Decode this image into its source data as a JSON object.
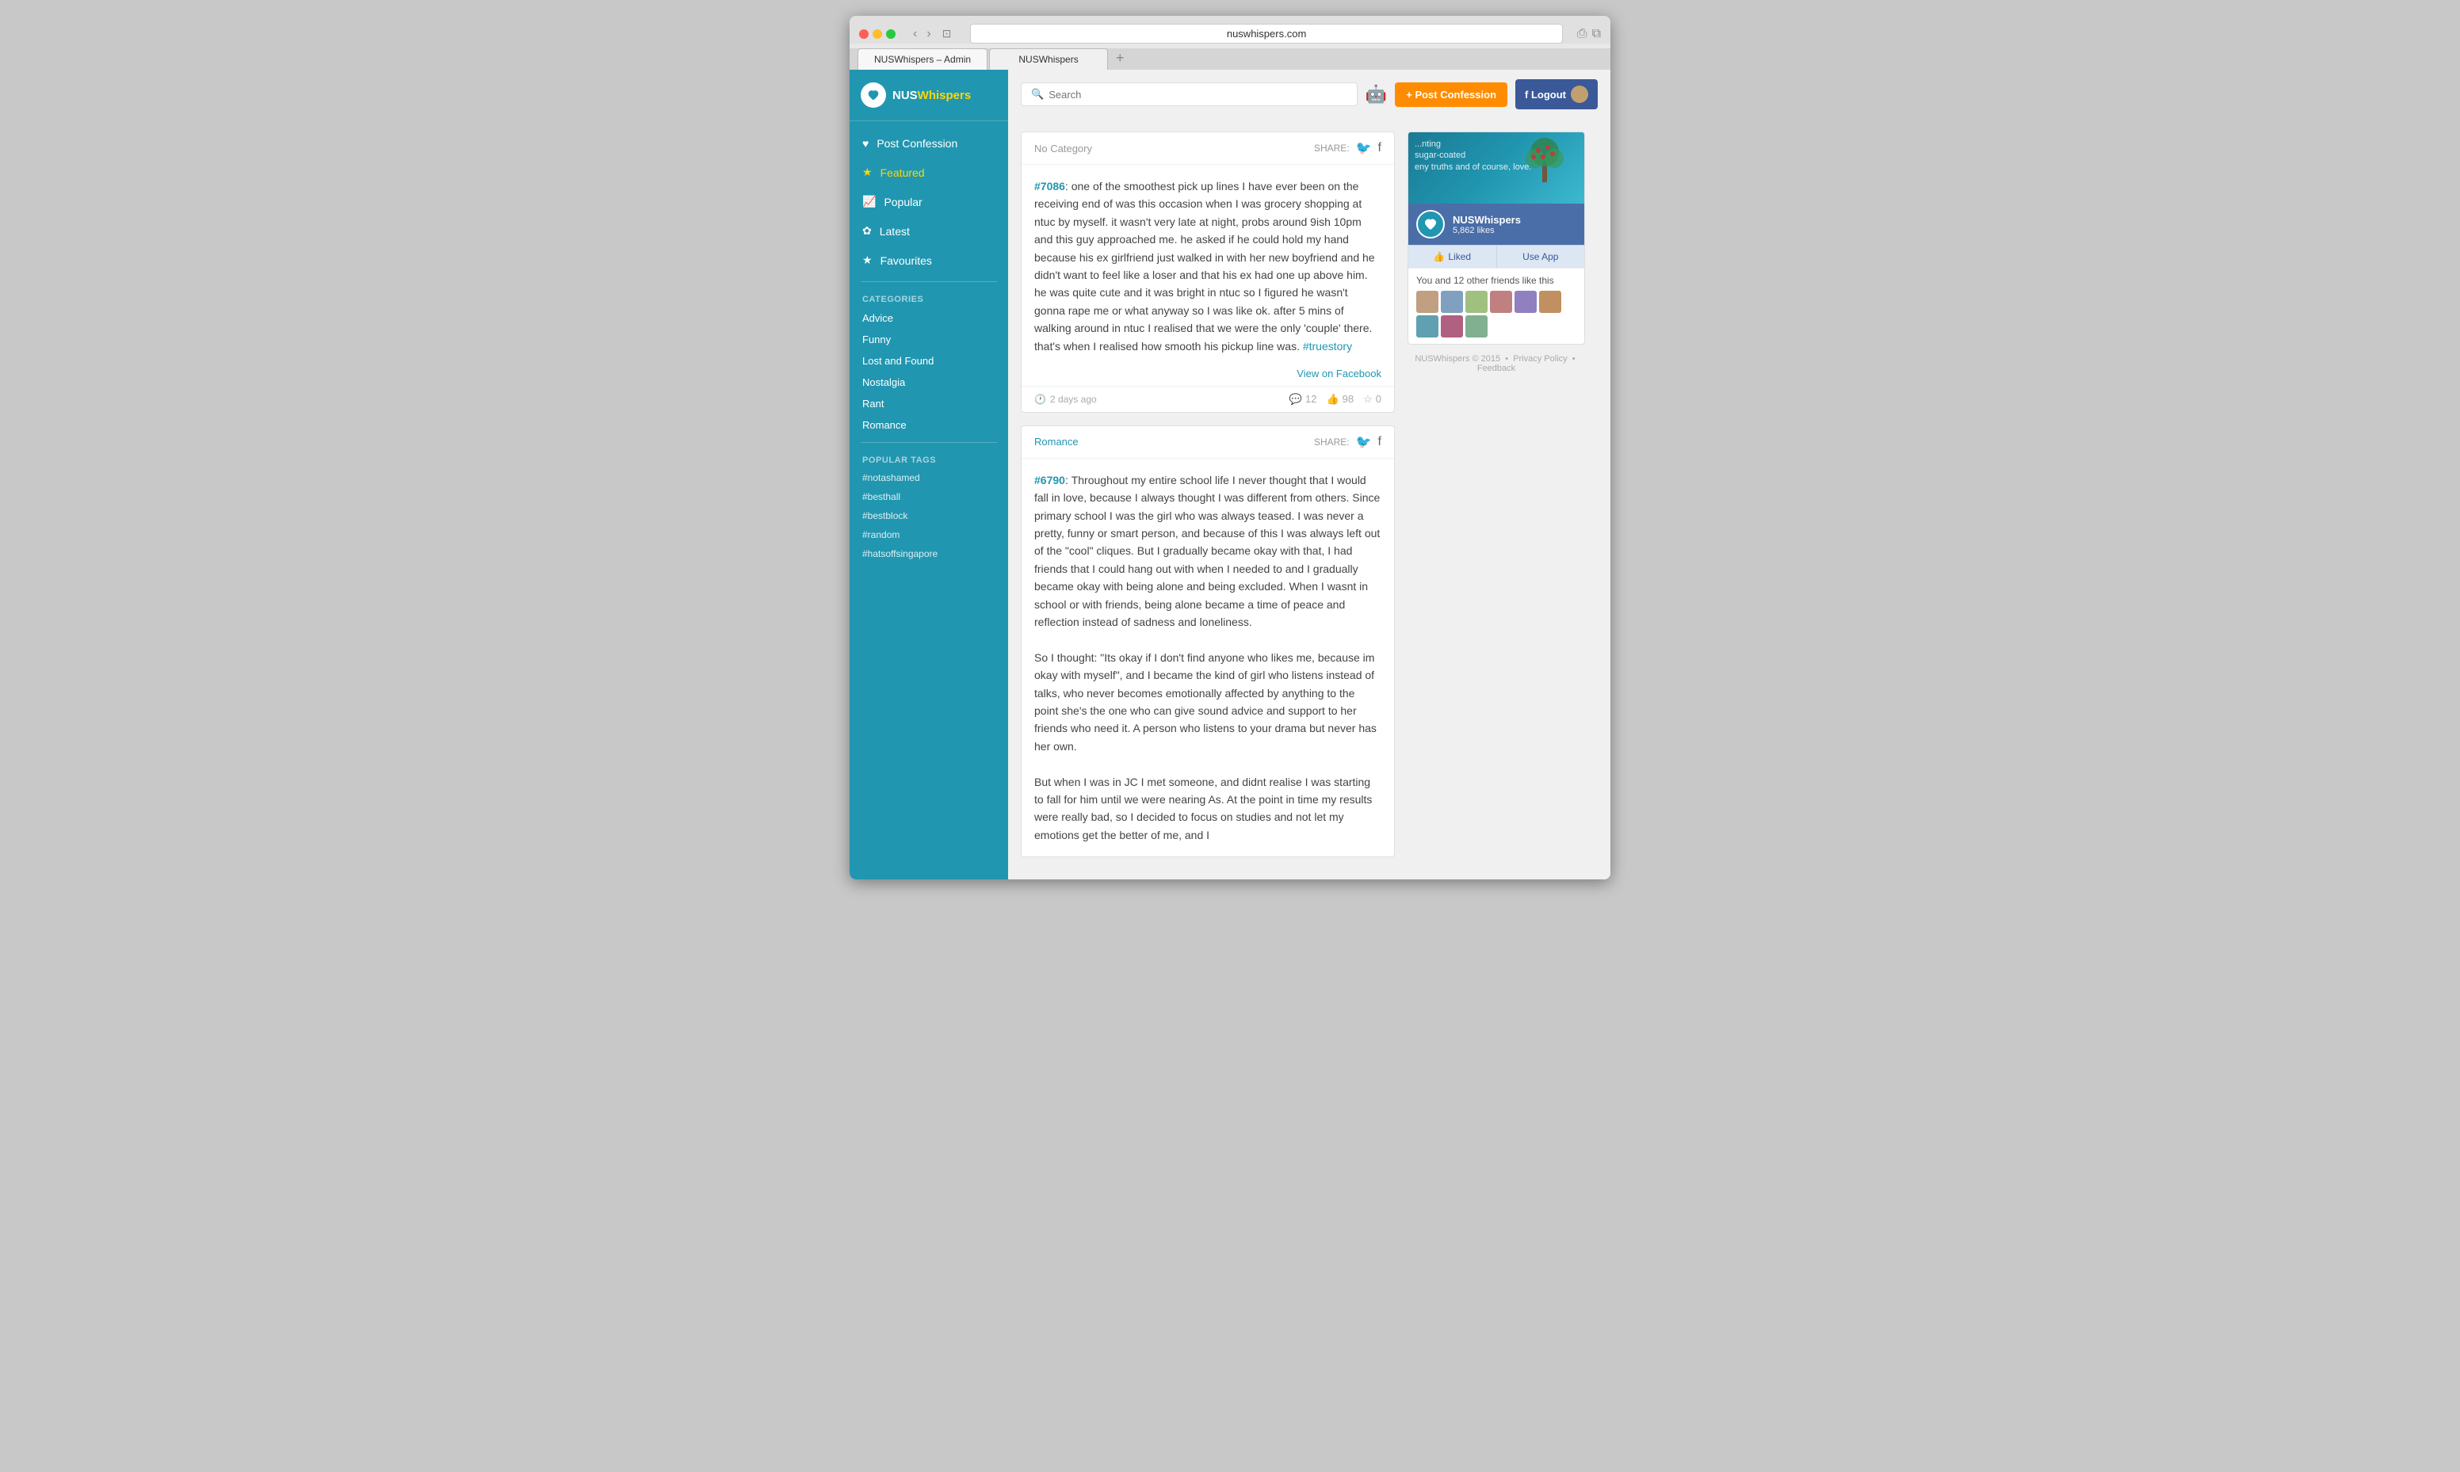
{
  "browser": {
    "url": "nuswhispers.com",
    "tabs": [
      {
        "label": "NUSWhispers – Admin",
        "active": true
      },
      {
        "label": "NUSWhispers",
        "active": false
      }
    ]
  },
  "sidebar": {
    "logo": {
      "text_nus": "NUS",
      "text_whispers": "Whispers"
    },
    "nav_items": [
      {
        "id": "post-confession",
        "icon": "♥",
        "label": "Post Confession",
        "active": false
      },
      {
        "id": "featured",
        "icon": "★",
        "label": "Featured",
        "active": true
      },
      {
        "id": "popular",
        "icon": "📈",
        "label": "Popular",
        "active": false
      },
      {
        "id": "latest",
        "icon": "✿",
        "label": "Latest",
        "active": false
      },
      {
        "id": "favourites",
        "icon": "★",
        "label": "Favourites",
        "active": false
      }
    ],
    "categories_title": "CATEGORIES",
    "categories": [
      {
        "label": "Advice"
      },
      {
        "label": "Funny"
      },
      {
        "label": "Lost and Found"
      },
      {
        "label": "Nostalgia"
      },
      {
        "label": "Rant"
      },
      {
        "label": "Romance"
      }
    ],
    "tags_title": "POPULAR TAGS",
    "tags": [
      "#notashamed",
      "#besthall",
      "#bestblock",
      "#random",
      "#hatsoffsingapore"
    ]
  },
  "topbar": {
    "search_placeholder": "Search",
    "post_confession_label": "+ Post Confession",
    "logout_label": "f Logout"
  },
  "posts": [
    {
      "category": "No Category",
      "share_label": "SHARE:",
      "id": "#7086",
      "body": "one of the smoothest pick up lines I have ever been on the receiving end of was this occasion when I was grocery shopping at ntuc by myself. it wasn't very late at night, probs around 9ish 10pm and this guy approached me. he asked if he could hold my hand because his ex girlfriend just walked in with her new boyfriend and he didn't want to feel like a loser and that his ex had one up above him. he was quite cute and it was bright in ntuc so I figured he wasn't gonna rape me or what anyway so I was like ok. after 5 mins of walking around in ntuc I realised that we were the only 'couple' there. that's when I realised how smooth his pickup line was. #truestory",
      "tag": "#truestory",
      "facebook_link": "View on Facebook",
      "time_ago": "2 days ago",
      "comments": "12",
      "likes": "98",
      "favourites": "0"
    },
    {
      "category": "Romance",
      "share_label": "SHARE:",
      "id": "#6790",
      "body": "Throughout my entire school life I never thought that I would fall in love, because I always thought I was different from others. Since primary school I was the girl who was always teased. I was never a pretty, funny or smart person, and because of this I was always left out of the \"cool\" cliques. But I gradually became okay with that, I had friends that I could hang out with when I needed to and I gradually became okay with being alone and being excluded. When I wasnt in school or with friends, being alone became a time of peace and reflection instead of sadness and loneliness.\n\nSo I thought: \"Its okay if I don't find anyone who likes me, because im okay with myself\", and I became the kind of girl who listens instead of talks, who never becomes emotionally affected by anything to the point she's the one who can give sound advice and support to her friends who need it. A person who listens to your drama but never has her own.\n\nBut when I was in JC I met someone, and didnt realise I was starting to fall for him until we were nearing As. At the point in time my results were really bad, so I decided to focus on studies and not let my emotions get the better of me, and I",
      "time_ago": "",
      "comments": "",
      "likes": "",
      "favourites": ""
    }
  ],
  "fb_widget": {
    "page_name": "NUSWhispers",
    "likes_count": "5,862 likes",
    "friends_text": "You and 12 other friends like this",
    "liked_label": "Liked",
    "use_app_label": "Use App"
  },
  "footer": {
    "copyright": "NUSWhispers © 2015",
    "privacy": "Privacy Policy",
    "feedback": "Feedback"
  }
}
